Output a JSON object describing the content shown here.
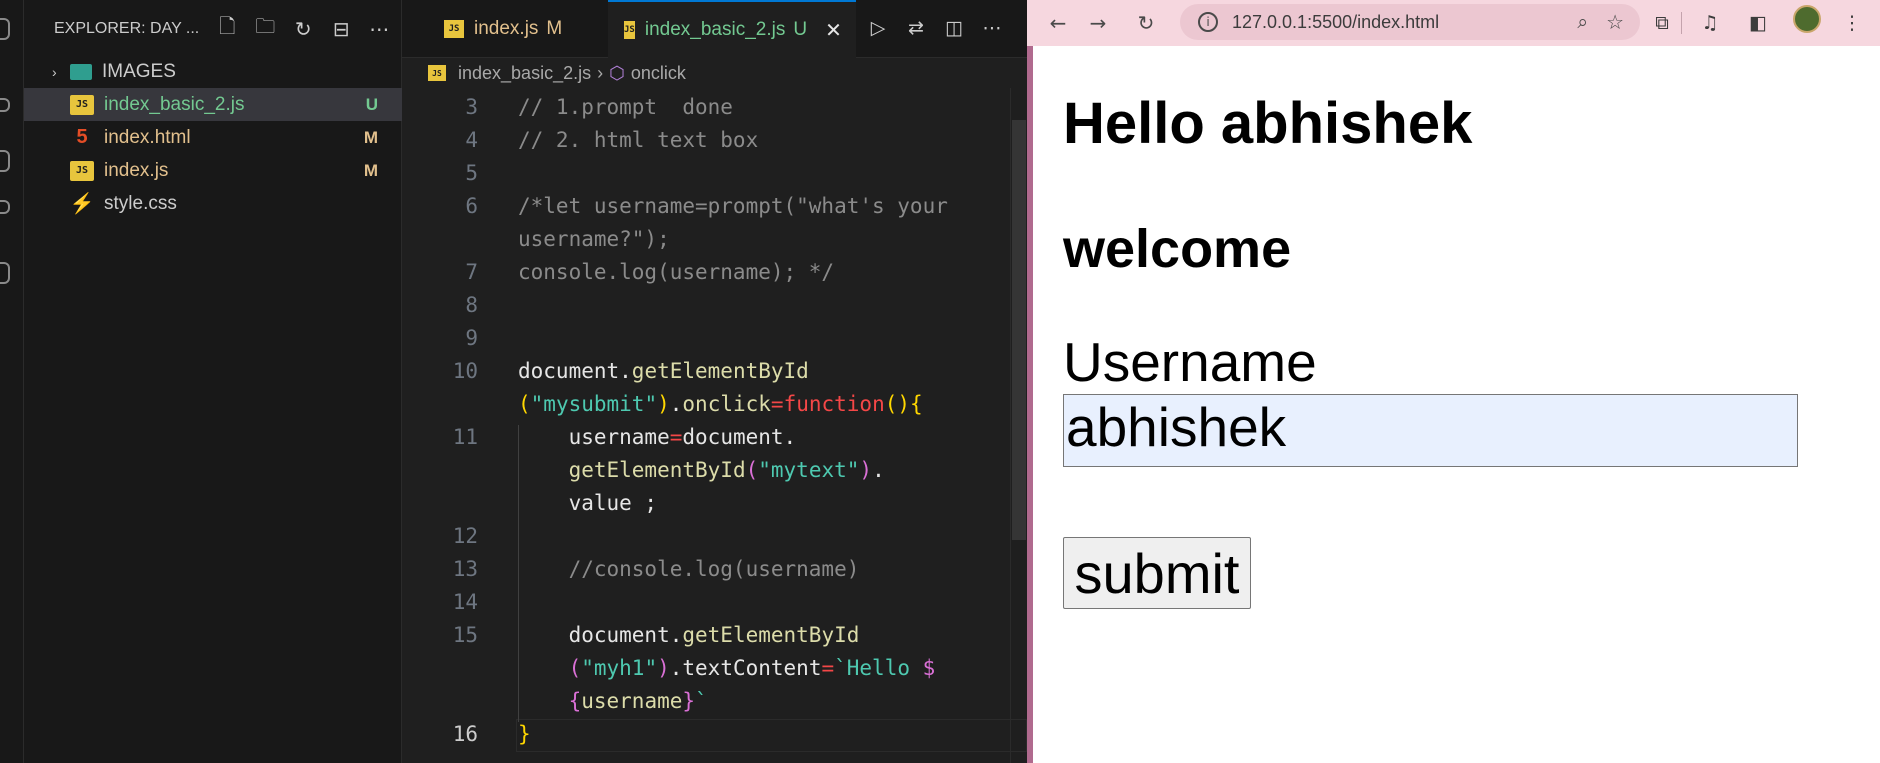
{
  "explorer": {
    "title": "EXPLORER: DAY ...",
    "files": [
      {
        "name": "IMAGES",
        "type": "folder",
        "status": ""
      },
      {
        "name": "index_basic_2.js",
        "type": "js",
        "status": "U"
      },
      {
        "name": "index.html",
        "type": "html",
        "status": "M"
      },
      {
        "name": "index.js",
        "type": "js",
        "status": "M"
      },
      {
        "name": "style.css",
        "type": "css",
        "status": ""
      }
    ],
    "icons": [
      "new-file-icon",
      "new-folder-icon",
      "refresh-icon",
      "collapse-icon",
      "more-icon"
    ]
  },
  "editor": {
    "tabs": [
      {
        "label": "index.js",
        "status": "M"
      },
      {
        "label": "index_basic_2.js",
        "status": "U"
      }
    ],
    "breadcrumb": {
      "file": "index_basic_2.js",
      "symbol": "onclick"
    },
    "active_line": "16",
    "line_numbers": [
      "3",
      "4",
      "5",
      "6",
      "7",
      "8",
      "9",
      "10",
      "11",
      "12",
      "13",
      "14",
      "15",
      "16"
    ]
  },
  "browser": {
    "url": "127.0.0.1:5500/index.html",
    "page": {
      "heading1": "Hello abhishek",
      "heading2": "welcome",
      "input_label": "Username",
      "input_value": "abhishek",
      "submit_label": "submit"
    }
  },
  "colors": {
    "editor_bg": "#1f1f1f",
    "sidebar_bg": "#181818",
    "modified": "#e2c08d",
    "untracked": "#73c991",
    "browser_toolbar": "#f6d7df",
    "autofill_bg": "#e8f0fe"
  }
}
